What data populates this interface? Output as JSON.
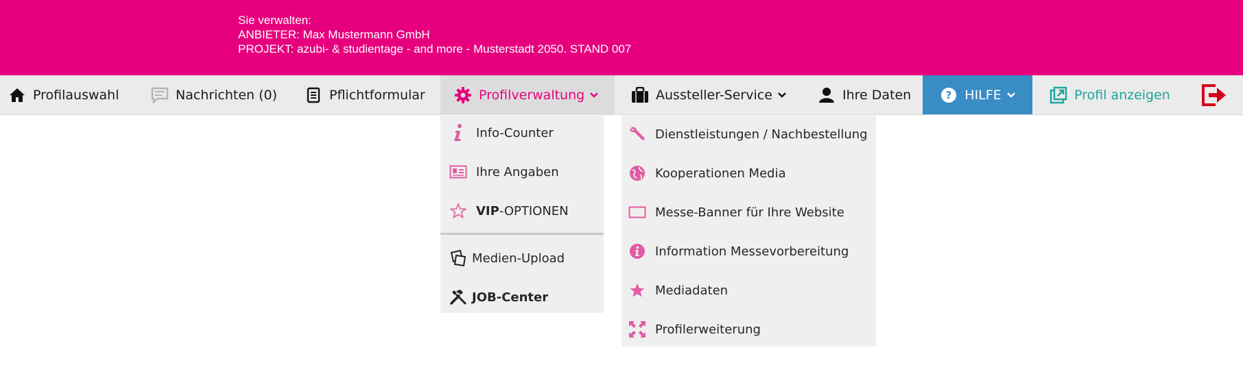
{
  "header": {
    "line1": "Sie verwalten:",
    "line2": "ANBIETER: Max Mustermann GmbH",
    "line3": "PROJEKT: azubi- & studientage - and more - Musterstadt 2050. STAND 007",
    "bg_color": "#e6007e"
  },
  "nav": {
    "items": [
      {
        "label": "Profilauswahl",
        "icon": "home-icon"
      },
      {
        "label": "Nachrichten (0)",
        "icon": "message-icon"
      },
      {
        "label": "Pflichtformular",
        "icon": "document-icon"
      },
      {
        "label": "Profilverwaltung",
        "icon": "gear-icon",
        "active": true
      },
      {
        "label": "Aussteller-Service",
        "icon": "briefcase-icon"
      },
      {
        "label": "Ihre Daten",
        "icon": "user-icon"
      },
      {
        "label": "HILFE",
        "icon": "help-icon"
      },
      {
        "label": "Profil anzeigen",
        "icon": "external-link-icon"
      }
    ],
    "logout_icon": "logout-icon",
    "accent_color": "#e6007e",
    "hilfe_color": "#3a8cc4",
    "profil_color": "#1aa59b"
  },
  "profilverwaltung_menu": {
    "items": [
      {
        "label": "Info-Counter",
        "icon": "info-italic-icon"
      },
      {
        "label": "Ihre Angaben",
        "icon": "id-card-icon"
      },
      {
        "label_bold": "VIP",
        "label_rest": "-OPTIONEN",
        "icon": "star-outline-icon"
      },
      {
        "label": "Medien-Upload",
        "icon": "media-upload-icon"
      },
      {
        "label": "JOB-Center",
        "icon": "tools-icon"
      }
    ]
  },
  "service_menu": {
    "items": [
      {
        "label": "Dienstleistungen / Nachbestellung",
        "icon": "wrench-icon"
      },
      {
        "label": "Kooperationen Media",
        "icon": "globe-icon"
      },
      {
        "label": "Messe-Banner für Ihre Website",
        "icon": "banner-icon"
      },
      {
        "label": "Information Messevorbereitung",
        "icon": "info-circle-icon"
      },
      {
        "label": "Mediadaten",
        "icon": "star-icon"
      },
      {
        "label": "Profilerweiterung",
        "icon": "expand-icon"
      }
    ]
  }
}
